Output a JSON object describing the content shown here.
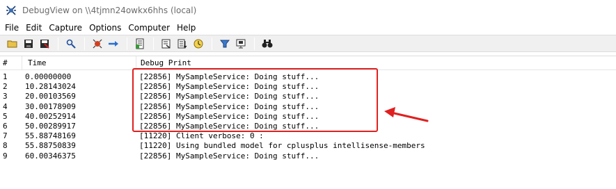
{
  "window": {
    "title": "DebugView on \\\\4tjmn24owkx6hhs (local)"
  },
  "menu": [
    "File",
    "Edit",
    "Capture",
    "Options",
    "Computer",
    "Help"
  ],
  "toolbar": {
    "icons": [
      "open-folder-icon",
      "save-icon",
      "save-as-icon",
      "find-icon",
      "capture-icon",
      "autoscroll-icon",
      "clear-icon",
      "filter-icon",
      "highlight-icon",
      "clock-icon",
      "history-icon",
      "options-icon",
      "find-binoculars-icon"
    ]
  },
  "table": {
    "columns": [
      "#",
      "Time",
      "Debug Print"
    ],
    "rows": [
      {
        "num": "1",
        "time": "0.00000000",
        "text": "[22856] MySampleService: Doing stuff..."
      },
      {
        "num": "2",
        "time": "10.28143024",
        "text": "[22856] MySampleService: Doing stuff..."
      },
      {
        "num": "3",
        "time": "20.00103569",
        "text": "[22856] MySampleService: Doing stuff..."
      },
      {
        "num": "4",
        "time": "30.00178909",
        "text": "[22856] MySampleService: Doing stuff..."
      },
      {
        "num": "5",
        "time": "40.00252914",
        "text": "[22856] MySampleService: Doing stuff..."
      },
      {
        "num": "6",
        "time": "50.00289917",
        "text": "[22856] MySampleService: Doing stuff..."
      },
      {
        "num": "7",
        "time": "55.88748169",
        "text": "[11220] Client verbose: 0 :"
      },
      {
        "num": "8",
        "time": "55.88750839",
        "text": "[11220] Using bundled model for cplusplus intellisense-members"
      },
      {
        "num": "9",
        "time": "60.00346375",
        "text": "[22856] MySampleService: Doing stuff..."
      }
    ]
  },
  "annotation": {
    "color": "#e02020"
  }
}
